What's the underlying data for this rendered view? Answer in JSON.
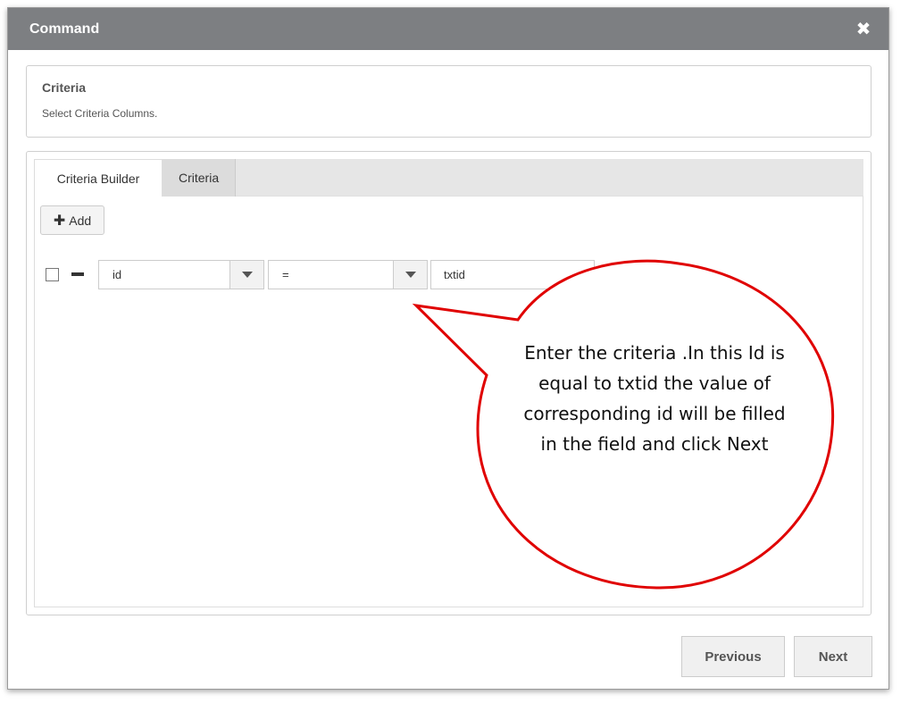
{
  "modal": {
    "title": "Command",
    "close_icon": "close-icon"
  },
  "info": {
    "title": "Criteria",
    "subtitle": "Select Criteria Columns."
  },
  "tabs": [
    {
      "label": "Criteria Builder",
      "active": true
    },
    {
      "label": "Criteria",
      "active": false
    }
  ],
  "builder": {
    "add_label": "Add",
    "row": {
      "field": "id",
      "operator": "=",
      "value": "txtid"
    }
  },
  "footer": {
    "previous_label": "Previous",
    "next_label": "Next"
  },
  "annotation": {
    "text": "Enter the criteria .In this Id is equal to txtid the value of corresponding id will be filled in the field and click Next",
    "color": "#e00000"
  },
  "colors": {
    "header_bg": "#7d7f82",
    "callout_stroke": "#e00000"
  }
}
